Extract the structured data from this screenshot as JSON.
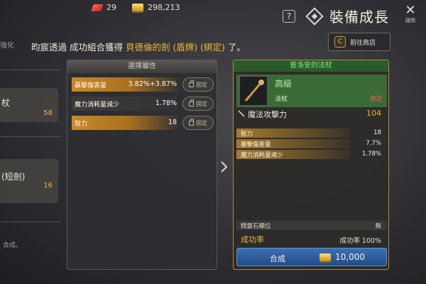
{
  "top": {
    "gems": "29",
    "gold": "298,213",
    "help": "?",
    "title": "裝備成長",
    "close_label": "離開"
  },
  "left": {
    "tab": "強化",
    "items": [
      {
        "name": "杖",
        "value": "58"
      },
      {
        "name": "(短劍)",
        "value": "16"
      }
    ],
    "footer": "合成。"
  },
  "notice": {
    "prefix": "昀宸透過 成功組合獲得 ",
    "item": "貝德倫的劍 (盾牌) (綁定)",
    "suffix": " 了。"
  },
  "shop_button": {
    "label": "前往商店",
    "icon": "C"
  },
  "property_panel": {
    "title": "選擇屬性",
    "rows": [
      {
        "name": "暴擊傷害量",
        "value": "3.82%+3.87%",
        "lock": "固定"
      },
      {
        "name": "魔力消耗量減少",
        "value": "1.78%",
        "lock": "固定"
      },
      {
        "name": "智力",
        "value": "18",
        "lock": "固定"
      }
    ]
  },
  "result_panel": {
    "item_name": "普洛安的法杖",
    "grade": "高級",
    "item_type": "法杖",
    "binding": "綁定",
    "main_stat": {
      "name": "魔法攻擊力",
      "value": "104"
    },
    "stats": [
      {
        "name": "智力",
        "value": "18"
      },
      {
        "name": "暴擊傷害量",
        "value": "7.7%"
      },
      {
        "name": "魔力消耗量減少",
        "value": "1.78%"
      }
    ],
    "socket": {
      "name": "精靈石欄位",
      "value": "無"
    },
    "success": {
      "label": "成功率",
      "value": "成功率 100%"
    },
    "craft": {
      "label": "合成",
      "cost": "10,000"
    }
  },
  "colors": {
    "accent_gold": "#e9b73f",
    "grade_green": "#7ef07a",
    "bind_red": "#ff5a4a",
    "button_blue": "#3c6fb3"
  }
}
